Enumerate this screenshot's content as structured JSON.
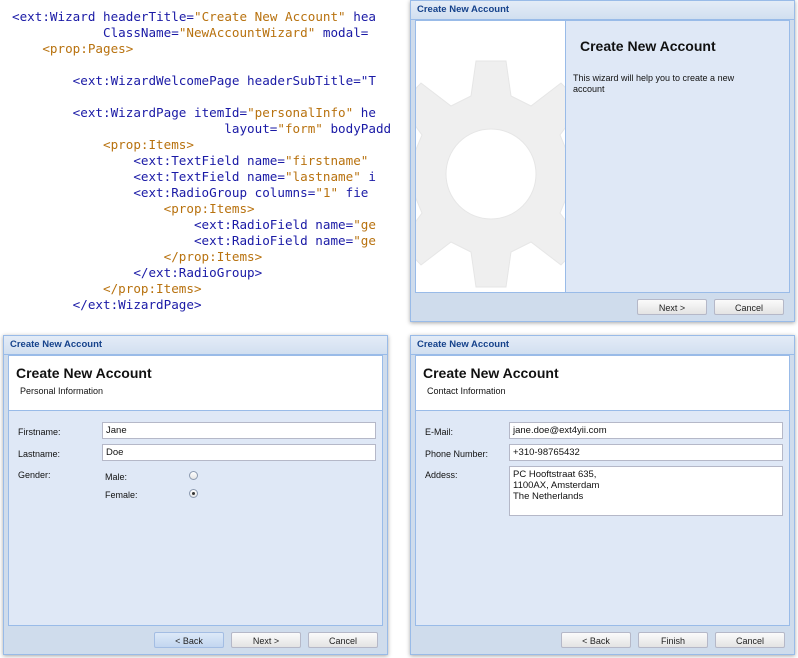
{
  "code": {
    "lines": [
      [
        [
          "tag",
          "<ext:Wizard "
        ],
        [
          "attr",
          "headerTitle="
        ],
        [
          "val",
          "\"Create New Account\""
        ],
        [
          "attr",
          " hea"
        ]
      ],
      [
        [
          "attr",
          "            ClassName="
        ],
        [
          "val",
          "\"NewAccountWizard\""
        ],
        [
          "attr",
          " modal="
        ]
      ],
      [
        [
          "ptag",
          "    <prop:Pages>"
        ]
      ],
      [],
      [
        [
          "tag",
          "        <ext:WizardWelcomePage "
        ],
        [
          "attr",
          "headerSubTitle=\"T"
        ]
      ],
      [],
      [
        [
          "tag",
          "        <ext:WizardPage "
        ],
        [
          "attr",
          "itemId="
        ],
        [
          "val",
          "\"personalInfo\""
        ],
        [
          "attr",
          " he"
        ]
      ],
      [
        [
          "attr",
          "                            layout="
        ],
        [
          "val",
          "\"form\""
        ],
        [
          "attr",
          " bodyPaddin"
        ]
      ],
      [
        [
          "ptag",
          "            <prop:Items>"
        ]
      ],
      [
        [
          "tag",
          "                <ext:TextField "
        ],
        [
          "attr",
          "name="
        ],
        [
          "val",
          "\"firstname\""
        ]
      ],
      [
        [
          "tag",
          "                <ext:TextField "
        ],
        [
          "attr",
          "name="
        ],
        [
          "val",
          "\"lastname\""
        ],
        [
          "attr",
          " i"
        ]
      ],
      [
        [
          "tag",
          "                <ext:RadioGroup "
        ],
        [
          "attr",
          "columns="
        ],
        [
          "val",
          "\"1\""
        ],
        [
          "attr",
          " fie"
        ]
      ],
      [
        [
          "ptag",
          "                    <prop:Items>"
        ]
      ],
      [
        [
          "tag",
          "                        <ext:RadioField "
        ],
        [
          "attr",
          "name="
        ],
        [
          "val",
          "\"ge"
        ]
      ],
      [
        [
          "tag",
          "                        <ext:RadioField "
        ],
        [
          "attr",
          "name="
        ],
        [
          "val",
          "\"ge"
        ]
      ],
      [
        [
          "ptag",
          "                    </prop:Items>"
        ]
      ],
      [
        [
          "tag",
          "                </ext:RadioGroup>"
        ]
      ],
      [
        [
          "ptag",
          "            </prop:Items>"
        ]
      ],
      [
        [
          "tag",
          "        </ext:WizardPage>"
        ]
      ]
    ]
  },
  "welcome": {
    "window_title": "Create New Account",
    "title": "Create New Account",
    "text": "This wizard will help you to create a new account",
    "next_label": "Next >",
    "cancel_label": "Cancel"
  },
  "personal": {
    "window_title": "Create New Account",
    "title": "Create New Account",
    "subtitle": "Personal Information",
    "firstname_label": "Firstname:",
    "firstname_value": "Jane",
    "lastname_label": "Lastname:",
    "lastname_value": "Doe",
    "gender_label": "Gender:",
    "male_label": "Male:",
    "female_label": "Female:",
    "back_label": "< Back",
    "next_label": "Next >",
    "cancel_label": "Cancel"
  },
  "contact": {
    "window_title": "Create New Account",
    "title": "Create New Account",
    "subtitle": "Contact Information",
    "email_label": "E-Mail:",
    "email_value": "jane.doe@ext4yii.com",
    "phone_label": "Phone Number:",
    "phone_value": "+310-98765432",
    "address_label": "Addess:",
    "address_value": "PC Hooftstraat 635,\n1100AX, Amsterdam\nThe Netherlands",
    "back_label": "< Back",
    "finish_label": "Finish",
    "cancel_label": "Cancel"
  }
}
